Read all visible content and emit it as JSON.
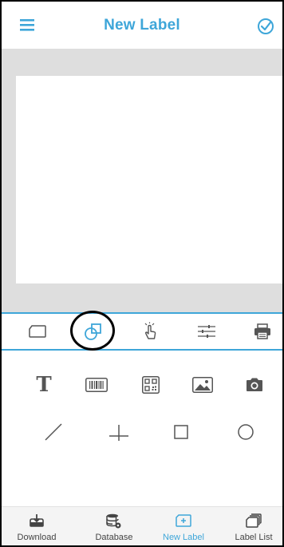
{
  "app": {
    "title": "New Label"
  },
  "header": {
    "menu_icon": "menu-icon",
    "confirm_icon": "check-circle-icon"
  },
  "toolbar": {
    "tools": [
      {
        "icon": "label-shape-icon"
      },
      {
        "icon": "shapes-overlap-icon",
        "selected": true
      },
      {
        "icon": "hand-tap-icon"
      },
      {
        "icon": "sliders-icon"
      },
      {
        "icon": "printer-icon"
      }
    ]
  },
  "elements": {
    "row1": [
      {
        "icon": "text-icon",
        "glyph": "T"
      },
      {
        "icon": "barcode-icon"
      },
      {
        "icon": "qrcode-icon"
      },
      {
        "icon": "image-icon"
      },
      {
        "icon": "camera-icon"
      }
    ],
    "row2": [
      {
        "icon": "line-icon"
      },
      {
        "icon": "crosshair-line-icon"
      },
      {
        "icon": "rectangle-icon"
      },
      {
        "icon": "circle-icon"
      }
    ]
  },
  "bottom_nav": {
    "items": [
      {
        "label": "Download",
        "icon": "download-icon"
      },
      {
        "label": "Database",
        "icon": "database-icon"
      },
      {
        "label": "New Label",
        "icon": "new-label-icon",
        "active": true
      },
      {
        "label": "Label List",
        "icon": "label-list-icon"
      }
    ]
  },
  "colors": {
    "accent": "#3ea6d9",
    "icon_gray": "#555555",
    "canvas_bg": "#dedede"
  }
}
